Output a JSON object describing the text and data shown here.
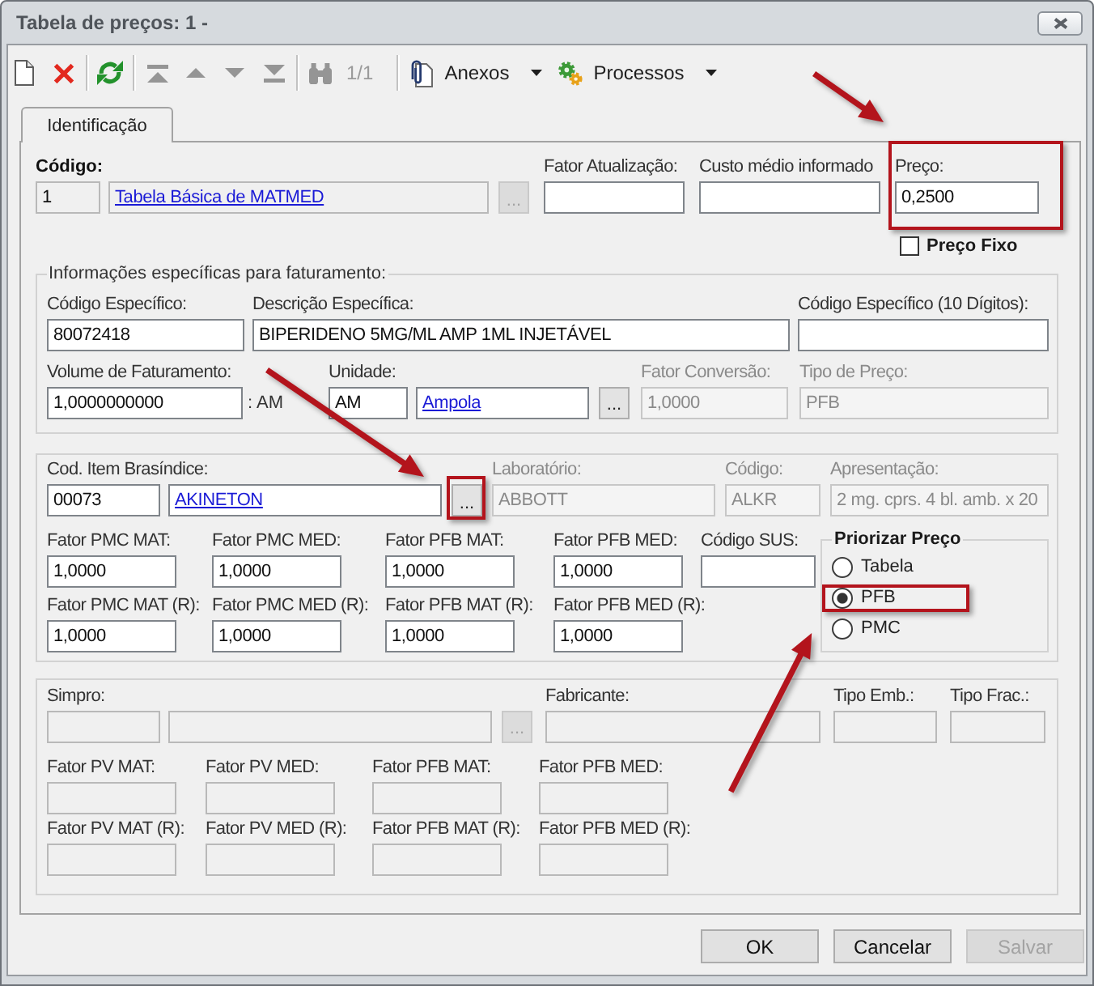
{
  "window": {
    "title": "Tabela de preços: 1 -"
  },
  "toolbar": [
    [
      {
        "kind": "new",
        "disabled": false
      },
      {
        "kind": "delete",
        "disabled": false
      }
    ],
    [
      {
        "kind": "refresh",
        "disabled": false
      }
    ],
    [
      {
        "kind": "first",
        "disabled": true
      },
      {
        "kind": "previous",
        "disabled": true
      },
      {
        "kind": "next",
        "disabled": true
      },
      {
        "kind": "last",
        "disabled": true
      }
    ],
    [
      {
        "kind": "find",
        "disabled": true
      },
      {
        "kind": "counter",
        "label": "1/1",
        "disabled": true
      }
    ],
    [
      {
        "kind": "attachments",
        "label": "Anexos",
        "disabled": false
      },
      {
        "kind": "processes",
        "label": "Processos",
        "disabled": false
      }
    ]
  ],
  "tabs": [
    {
      "label": "Identificação",
      "selected": true
    }
  ],
  "header": {
    "codigo": {
      "label": "Código:",
      "code": "1",
      "name": "Tabela Básica de MATMED",
      "disabled": false,
      "readonly": true,
      "button": {
        "label": "...",
        "disabled": true,
        "highlighted": false
      }
    },
    "fields": [
      {
        "kind": "text",
        "label": "Fator Atualização:",
        "disabled": false,
        "readonly": false,
        "highlighted": false
      },
      {
        "kind": "text",
        "label": "Custo médio informado",
        "disabled": false,
        "readonly": false,
        "highlighted": false
      },
      {
        "kind": "text",
        "label": "Preço:",
        "value": "0,2500",
        "disabled": false,
        "readonly": false,
        "highlighted": true
      }
    ],
    "preco_fixo": {
      "label": "Preço Fixo",
      "checked": false
    }
  },
  "faturamento": {
    "title": "Informações específicas para faturamento:",
    "lines": [
      {
        "fields": [
          {
            "kind": "text",
            "label": "Código Específico:",
            "value": "80072418",
            "disabled": false,
            "readonly": false
          },
          {
            "kind": "text",
            "label": "Descrição Específica:",
            "value": "BIPERIDENO 5MG/ML AMP 1ML INJETÁVEL",
            "disabled": false,
            "readonly": false
          },
          {
            "kind": "text",
            "label": "Código Específico (10 Dígitos):",
            "disabled": false,
            "readonly": false
          }
        ]
      },
      {
        "fields": [
          {
            "kind": "text",
            "label": "Volume de Faturamento:",
            "value": "1,0000000000",
            "suffix": ": AM",
            "disabled": false,
            "readonly": false
          },
          {
            "kind": "lookup",
            "label": "Unidade:",
            "code": "AM",
            "name": "Ampola",
            "disabled": false,
            "readonly": false,
            "button": {
              "label": "...",
              "disabled": false,
              "highlighted": false
            }
          },
          {
            "kind": "text",
            "label": "Fator Conversão:",
            "value": "1,0000",
            "disabled": true,
            "readonly": false
          },
          {
            "kind": "text",
            "label": "Tipo de Preço:",
            "value": "PFB",
            "disabled": true,
            "readonly": false
          }
        ]
      }
    ]
  },
  "brasindice": {
    "lines": [
      {
        "fields": [
          {
            "kind": "lookup",
            "label": "Cod. Item Brasíndice:",
            "code": "00073",
            "name": "AKINETON",
            "disabled": false,
            "readonly": false,
            "button": {
              "label": "...",
              "disabled": false,
              "highlighted": true
            }
          },
          {
            "kind": "text",
            "label": "Laboratório:",
            "value": "ABBOTT",
            "disabled": true,
            "readonly": false
          },
          {
            "kind": "text",
            "label": "Código:",
            "value": "ALKR",
            "disabled": true,
            "readonly": false
          },
          {
            "kind": "text",
            "label": "Apresentação:",
            "value": "2 mg. cprs. 4 bl. amb. x 20",
            "disabled": true,
            "readonly": false
          }
        ]
      },
      {
        "fields": [
          {
            "kind": "text",
            "label": "Fator PMC MAT:",
            "value": "1,0000",
            "disabled": false,
            "readonly": false
          },
          {
            "kind": "text",
            "label": "Fator PMC MED:",
            "value": "1,0000",
            "disabled": false,
            "readonly": false
          },
          {
            "kind": "text",
            "label": "Fator PFB MAT:",
            "value": "1,0000",
            "disabled": false,
            "readonly": false
          },
          {
            "kind": "text",
            "label": "Fator PFB MED:",
            "value": "1,0000",
            "disabled": false,
            "readonly": false
          },
          {
            "kind": "text",
            "label": "Código SUS:",
            "disabled": false,
            "readonly": false
          }
        ]
      },
      {
        "fields": [
          {
            "kind": "text",
            "label": "Fator PMC MAT (R):",
            "value": "1,0000",
            "disabled": false,
            "readonly": false
          },
          {
            "kind": "text",
            "label": "Fator PMC MED (R):",
            "value": "1,0000",
            "disabled": false,
            "readonly": false
          },
          {
            "kind": "text",
            "label": "Fator PFB MAT (R):",
            "value": "1,0000",
            "disabled": false,
            "readonly": false
          },
          {
            "kind": "text",
            "label": "Fator PFB MED (R):",
            "value": "1,0000",
            "disabled": false,
            "readonly": false
          }
        ]
      }
    ],
    "priorizar": {
      "title": "Priorizar Preço",
      "options": [
        {
          "label": "Tabela",
          "selected": false,
          "highlighted": false
        },
        {
          "label": "PFB",
          "selected": true,
          "highlighted": true
        },
        {
          "label": "PMC",
          "selected": false,
          "highlighted": false
        }
      ]
    }
  },
  "simpro": {
    "lines": [
      {
        "fields": [
          {
            "kind": "lookup",
            "label": "Simpro:",
            "disabled": false,
            "readonly": true,
            "button": {
              "label": "...",
              "disabled": true,
              "highlighted": false
            }
          },
          {
            "kind": "text",
            "label": "Fabricante:",
            "disabled": false,
            "readonly": true
          },
          {
            "kind": "text",
            "label": "Tipo Emb.:",
            "disabled": false,
            "readonly": true
          },
          {
            "kind": "text",
            "label": "Tipo Frac.:",
            "disabled": false,
            "readonly": true
          }
        ]
      },
      {
        "fields": [
          {
            "kind": "text",
            "label": "Fator PV MAT:",
            "disabled": false,
            "readonly": true
          },
          {
            "kind": "text",
            "label": "Fator PV MED:",
            "disabled": false,
            "readonly": true
          },
          {
            "kind": "text",
            "label": "Fator PFB MAT:",
            "disabled": false,
            "readonly": true
          },
          {
            "kind": "text",
            "label": "Fator PFB MED:",
            "disabled": false,
            "readonly": true
          }
        ]
      },
      {
        "fields": [
          {
            "kind": "text",
            "label": "Fator PV MAT (R):",
            "disabled": false,
            "readonly": true
          },
          {
            "kind": "text",
            "label": "Fator PV MED (R):",
            "disabled": false,
            "readonly": true
          },
          {
            "kind": "text",
            "label": "Fator PFB MAT (R):",
            "disabled": false,
            "readonly": true
          },
          {
            "kind": "text",
            "label": "Fator PFB MED (R):",
            "disabled": false,
            "readonly": true
          }
        ]
      }
    ]
  },
  "buttons": [
    {
      "label": "OK",
      "disabled": false
    },
    {
      "label": "Cancelar",
      "disabled": false
    },
    {
      "label": "Salvar",
      "disabled": true
    }
  ]
}
